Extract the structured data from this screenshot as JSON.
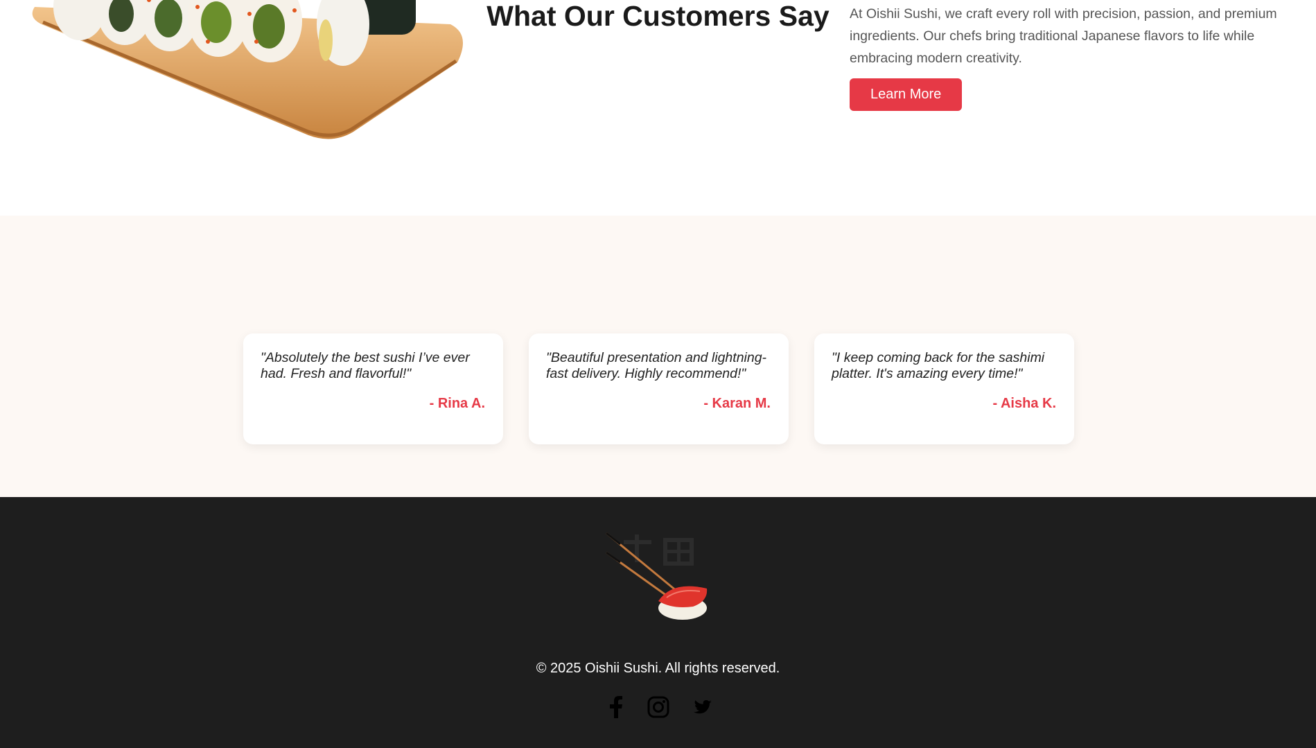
{
  "about": {
    "description": "At Oishii Sushi, we craft every roll with precision, passion, and premium ingredients. Our chefs bring traditional Japanese flavors to life while embracing modern creativity.",
    "learn_more_label": "Learn More"
  },
  "testimonials": {
    "heading": "What Our Customers Say",
    "items": [
      {
        "quote": "\"Absolutely the best sushi I’ve ever had. Fresh and flavorful!\"",
        "author": "- Rina A."
      },
      {
        "quote": "\"Beautiful presentation and lightning-fast delivery. Highly recommend!\"",
        "author": "- Karan M."
      },
      {
        "quote": "\"I keep coming back for the sashimi platter. It's amazing every time!\"",
        "author": "- Aisha K."
      }
    ]
  },
  "footer": {
    "copyright": "© 2025 Oishii Sushi. All rights reserved.",
    "socials": [
      "facebook-icon",
      "instagram-icon",
      "twitter-icon"
    ]
  },
  "colors": {
    "accent": "#e63946",
    "testimonial_bg": "#fdf8f4",
    "footer_bg": "#1e1e1e"
  }
}
